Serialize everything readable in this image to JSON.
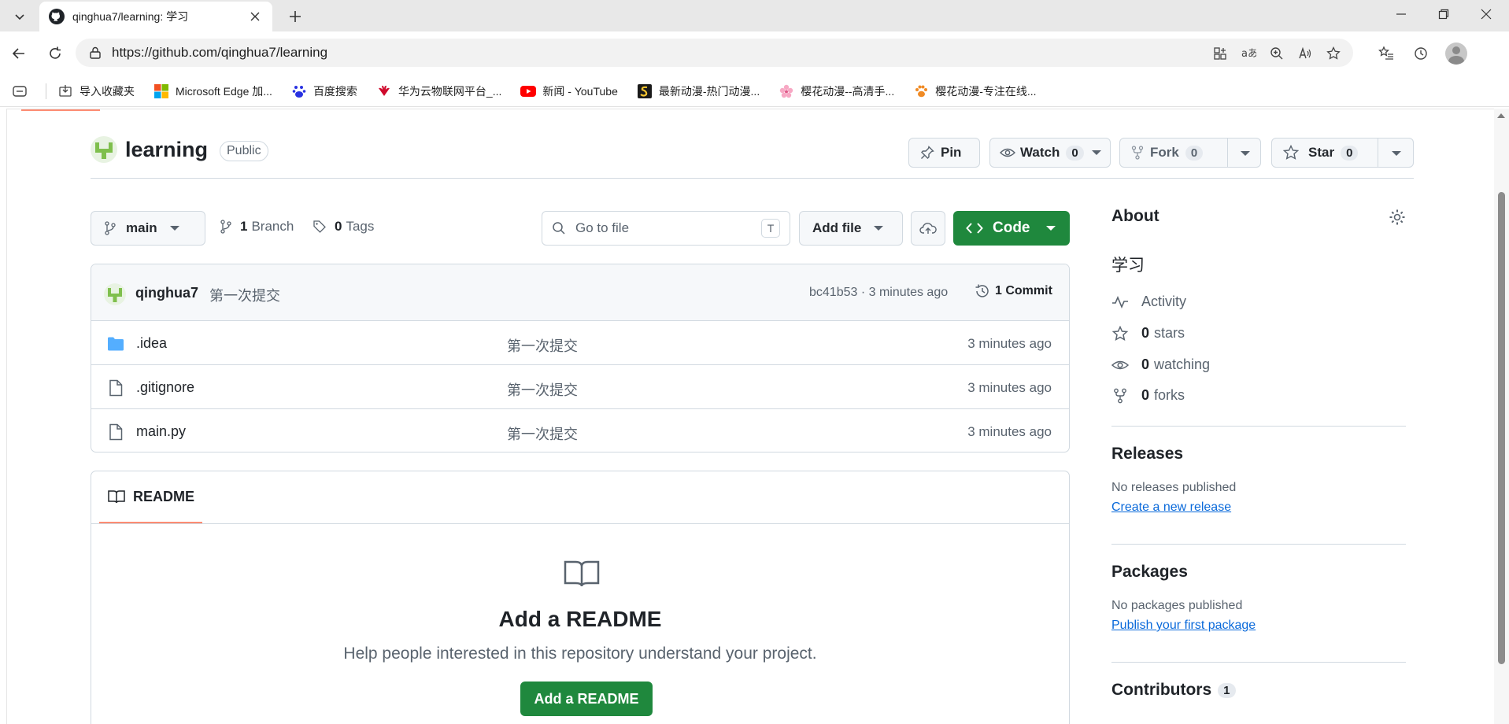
{
  "browser": {
    "tab_title": "qinghua7/learning: 学习",
    "url": "https://github.com/qinghua7/learning",
    "bookmarks": [
      {
        "label": "导入收藏夹",
        "icon": "import-icon"
      },
      {
        "label": "Microsoft Edge 加...",
        "icon": "microsoft-icon"
      },
      {
        "label": "百度搜索",
        "icon": "baidu-icon"
      },
      {
        "label": "华为云物联网平台_...",
        "icon": "huawei-icon"
      },
      {
        "label": "新闻 - YouTube",
        "icon": "youtube-icon"
      },
      {
        "label": "最新动漫-热门动漫...",
        "icon": "s-logo-icon"
      },
      {
        "label": "樱花动漫--高清手...",
        "icon": "sakura-icon"
      },
      {
        "label": "樱花动漫-专注在线...",
        "icon": "paw-icon"
      }
    ]
  },
  "repo": {
    "name": "learning",
    "visibility": "Public",
    "pin_label": "Pin",
    "watch_label": "Watch",
    "watch_count": "0",
    "fork_label": "Fork",
    "fork_count": "0",
    "star_label": "Star",
    "star_count": "0"
  },
  "toolbar": {
    "branch": "main",
    "branch_count": "1",
    "branch_label": "Branch",
    "tag_count": "0",
    "tag_label": "Tags",
    "search_placeholder": "Go to file",
    "search_shortcut": "T",
    "add_file_label": "Add file",
    "code_label": "Code"
  },
  "commit": {
    "user": "qinghua7",
    "message": "第一次提交",
    "meta": "bc41b53 · 3 minutes ago",
    "count_label": "1 Commit"
  },
  "files": [
    {
      "name": ".idea",
      "type": "folder",
      "message": "第一次提交",
      "time": "3 minutes ago"
    },
    {
      "name": ".gitignore",
      "type": "file",
      "message": "第一次提交",
      "time": "3 minutes ago"
    },
    {
      "name": "main.py",
      "type": "file",
      "message": "第一次提交",
      "time": "3 minutes ago"
    }
  ],
  "readme": {
    "tab_label": "README",
    "title": "Add a README",
    "subtitle": "Help people interested in this repository understand your project.",
    "button_label": "Add a README"
  },
  "about": {
    "heading": "About",
    "description": "学习",
    "activity": "Activity",
    "stars_count": "0",
    "stars_label": "stars",
    "watching_count": "0",
    "watching_label": "watching",
    "forks_count": "0",
    "forks_label": "forks",
    "releases_heading": "Releases",
    "releases_note": "No releases published",
    "releases_link": "Create a new release",
    "packages_heading": "Packages",
    "packages_note": "No packages published",
    "packages_link": "Publish your first package",
    "contributors_heading": "Contributors",
    "contributors_count": "1"
  },
  "colors": {
    "primary_green": "#1f883d",
    "link_blue": "#0969da",
    "tab_underline": "#fd8c73",
    "folder_blue": "#54aeff"
  }
}
